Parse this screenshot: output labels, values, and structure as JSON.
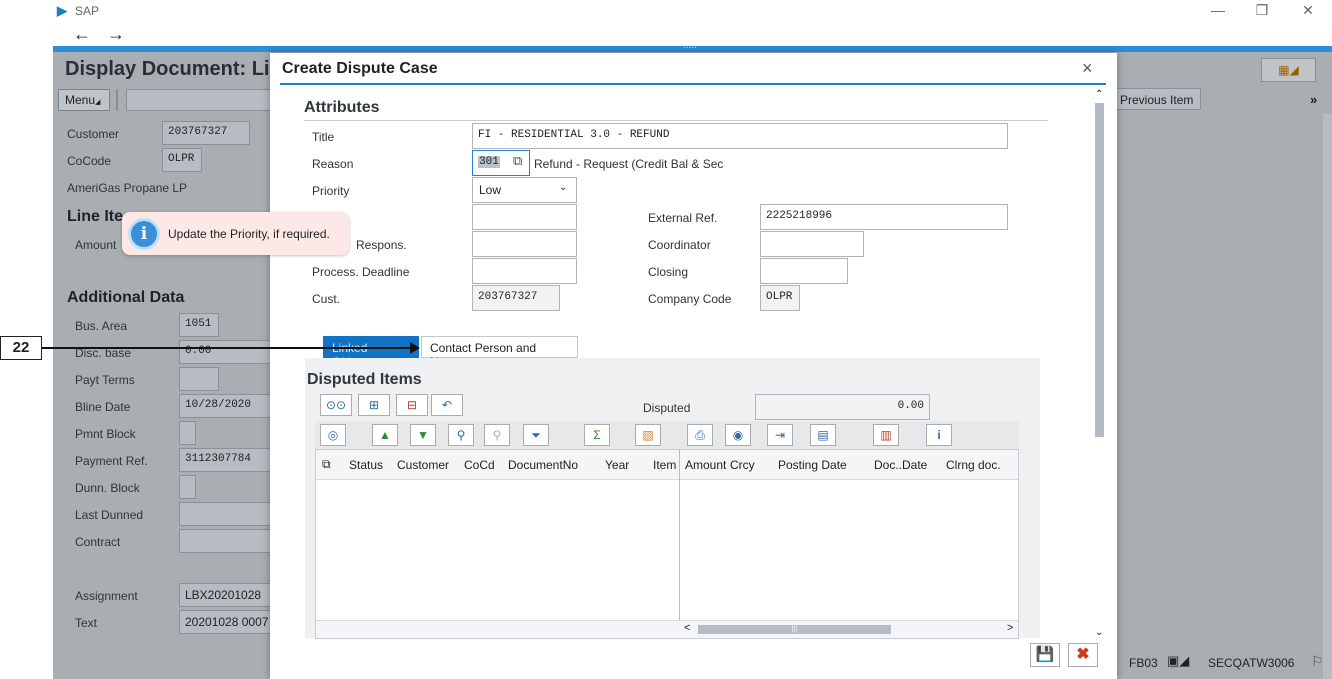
{
  "window": {
    "app_name": "SAP",
    "minimize": "—",
    "restore": "❐",
    "close": "✕",
    "back": "←",
    "forward": "→",
    "grip": "....."
  },
  "background": {
    "title": "Display Document: Li",
    "menu_label": "Menu",
    "previous_item": "Previous Item",
    "more": "»",
    "header_fields": [
      {
        "label": "Customer",
        "value": "203767327"
      },
      {
        "label": "CoCode",
        "value": "OLPR"
      }
    ],
    "company_name": "AmeriGas Propane LP",
    "line_items_heading": "Line Ite",
    "amount_label": "Amount",
    "additional_data_heading": "Additional Data",
    "fields": [
      {
        "label": "Bus. Area",
        "value": "1051"
      },
      {
        "label": "Disc. base",
        "value": "0.00"
      },
      {
        "label": "Payt Terms",
        "value": ""
      },
      {
        "label": "Bline Date",
        "value": "10/28/2020"
      },
      {
        "label": "Pmnt Block",
        "value": ""
      },
      {
        "label": "Payment Ref.",
        "value": "3112307784"
      },
      {
        "label": "Dunn. Block",
        "value": ""
      },
      {
        "label": "Last Dunned",
        "value": ""
      },
      {
        "label": "Contract",
        "value": ""
      }
    ],
    "assignment": {
      "label": "Assignment",
      "value": "LBX20201028"
    },
    "text": {
      "label": "Text",
      "value": "20201028 0007"
    },
    "status_tcode": "FB03",
    "status_system": "SECQATW3006"
  },
  "dialog": {
    "title": "Create Dispute Case",
    "close": "×",
    "attributes_heading": "Attributes",
    "title_label": "Title",
    "title_value": "FI - RESIDENTIAL 3.0 - REFUND",
    "reason_label": "Reason",
    "reason_code": "301",
    "reason_text": "Refund - Request (Credit Bal & Sec",
    "priority_label": "Priority",
    "priority_value": "Low",
    "external_ref_label": "External Ref.",
    "external_ref_value": "2225218996",
    "respons_label": "Respons.",
    "coordinator_label": "Coordinator",
    "deadline_label": "Process. Deadline",
    "closing_label": "Closing",
    "cust_label": "Cust.",
    "cust_value": "203767327",
    "company_code_label": "Company Code",
    "company_code_value": "OLPR",
    "tabs": [
      "Linked Objects",
      "Contact Person and Notes"
    ],
    "disputed_heading": "Disputed Items",
    "disputed_label": "Disputed",
    "disputed_value": "0.00",
    "columns": [
      "Status",
      "Customer",
      "CoCd",
      "DocumentNo",
      "Year",
      "Item",
      "Amount",
      "Crcy",
      "Posting Date",
      "Doc..Date",
      "Clrng doc."
    ],
    "scroll_left": "<",
    "scroll_right": ">",
    "scroll_grip": "|||"
  },
  "tooltip": {
    "text": "Update the Priority, if required.",
    "icon": "i"
  },
  "step_marker": "22"
}
